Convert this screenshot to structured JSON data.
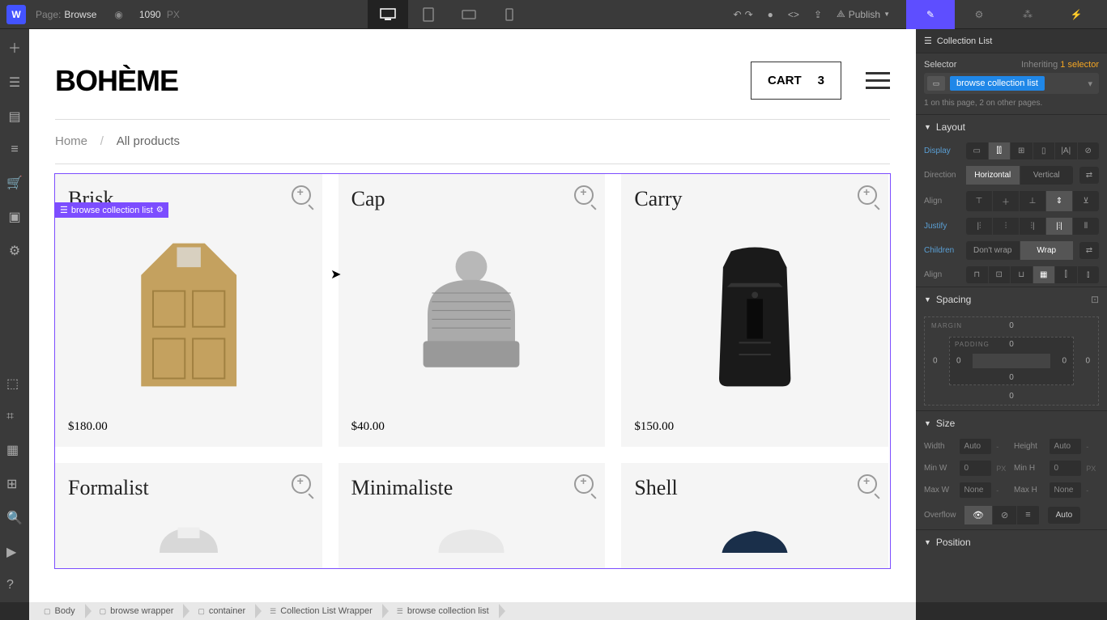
{
  "toolbar": {
    "page_label": "Page:",
    "page_name": "Browse",
    "width": "1090",
    "width_unit": "PX",
    "publish": "Publish"
  },
  "panel_tabs": [
    "brush",
    "settings",
    "effects",
    "interactions"
  ],
  "site": {
    "brand": "BOHÈME",
    "cart_label": "CART",
    "cart_count": "3",
    "breadcrumb_home": "Home",
    "breadcrumb_all": "All products"
  },
  "collection_tag": "browse collection list",
  "products": [
    {
      "name": "Brisk",
      "price": "$180.00"
    },
    {
      "name": "Cap",
      "price": "$40.00"
    },
    {
      "name": "Carry",
      "price": "$150.00"
    },
    {
      "name": "Formalist",
      "price": ""
    },
    {
      "name": "Minimaliste",
      "price": ""
    },
    {
      "name": "Shell",
      "price": ""
    }
  ],
  "right": {
    "header": "Collection List",
    "selector_label": "Selector",
    "inheriting": "Inheriting",
    "inherit_count": "1 selector",
    "chip": "browse collection list",
    "count_text": "1 on this page, 2 on other pages.",
    "layout": {
      "title": "Layout",
      "display": "Display",
      "direction": "Direction",
      "direction_options": [
        "Horizontal",
        "Vertical"
      ],
      "align": "Align",
      "justify": "Justify",
      "children": "Children",
      "children_options": [
        "Don't wrap",
        "Wrap"
      ],
      "align2": "Align"
    },
    "spacing": {
      "title": "Spacing",
      "margin": "MARGIN",
      "padding": "PADDING",
      "m_top": "0",
      "m_right": "0",
      "m_bottom": "0",
      "m_left": "0",
      "p_top": "0",
      "p_right": "0",
      "p_bottom": "0",
      "p_left": "0"
    },
    "size": {
      "title": "Size",
      "width": "Width",
      "height": "Height",
      "minw": "Min W",
      "minh": "Min H",
      "maxw": "Max W",
      "maxh": "Max H",
      "auto": "Auto",
      "zero": "0",
      "none": "None",
      "dash": "-",
      "px": "PX",
      "overflow": "Overflow",
      "overflow_auto": "Auto"
    },
    "position": {
      "title": "Position"
    }
  },
  "bottom_crumb": [
    "Body",
    "browse wrapper",
    "container",
    "Collection List Wrapper",
    "browse collection list"
  ]
}
